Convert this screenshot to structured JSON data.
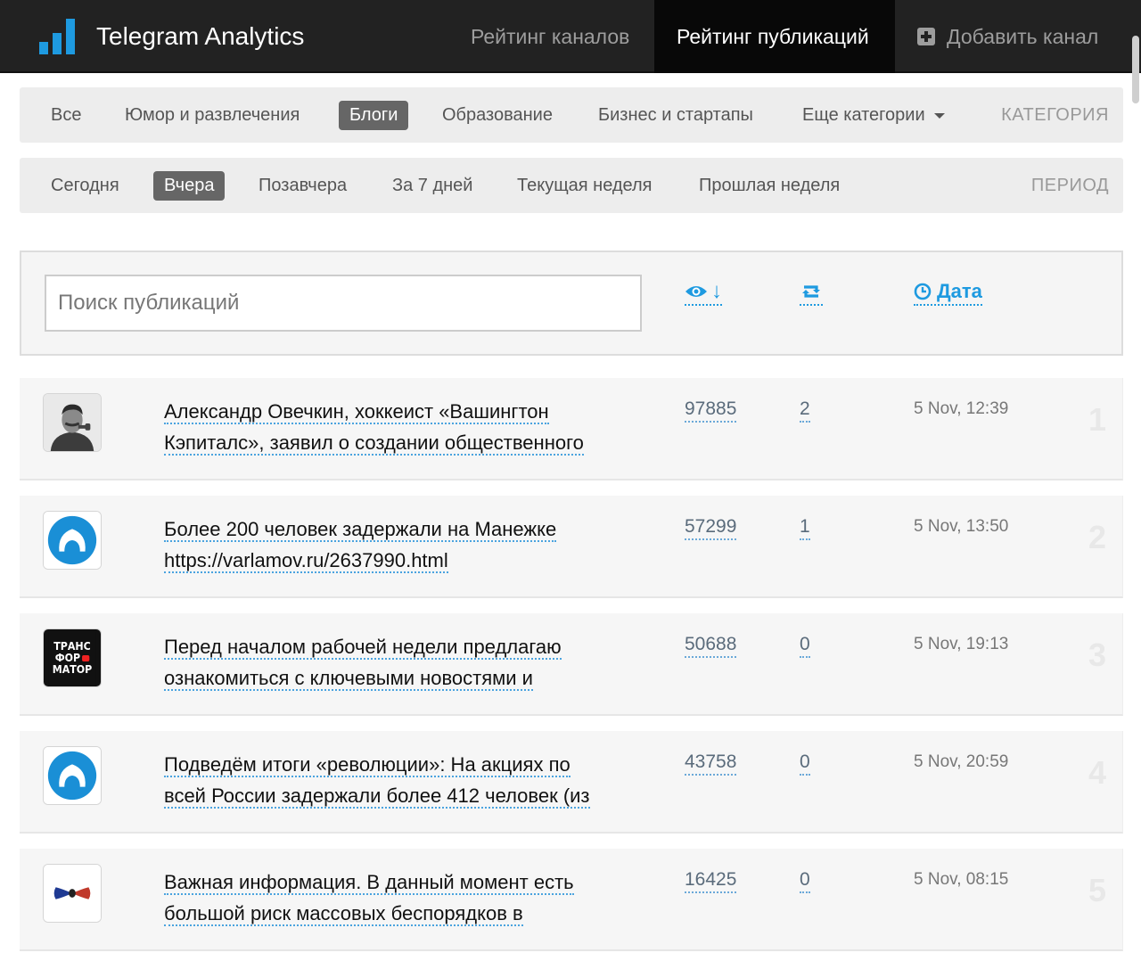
{
  "nav": {
    "brand_title": "Telegram Analytics",
    "items": [
      {
        "label": "Рейтинг каналов"
      },
      {
        "label": "Рейтинг публикаций"
      },
      {
        "label": "Добавить канал"
      }
    ]
  },
  "categories": {
    "items": [
      "Все",
      "Юмор и развлечения",
      "Блоги",
      "Образование",
      "Бизнес и стартапы",
      "Еще категории"
    ],
    "active": "Блоги",
    "label": "КАТЕГОРИЯ"
  },
  "periods": {
    "items": [
      "Сегодня",
      "Вчера",
      "Позавчера",
      "За 7 дней",
      "Текущая неделя",
      "Прошлая неделя"
    ],
    "active": "Вчера",
    "label": "ПЕРИОД"
  },
  "search": {
    "placeholder": "Поиск публикаций",
    "value": "",
    "views_arrow": "↓",
    "date_label": "Дата"
  },
  "colors": {
    "accent": "#1e9ae0",
    "navbar": "#222222"
  },
  "posts": [
    {
      "title_line1": "Александр Овечкин, хоккеист «Вашингтон",
      "title_line2": "Кэпиталс», заявил о создании общественного",
      "views": "97885",
      "shares": "2",
      "date": "5 Nov, 12:39",
      "rank": "1",
      "avatar": "portrait-avatar"
    },
    {
      "title_line1": "Более 200 человек задержали на Манежке",
      "title_line2": "https://varlamov.ru/2637990.html",
      "views": "57299",
      "shares": "1",
      "date": "5 Nov, 13:50",
      "rank": "2",
      "avatar": "blue-circle-avatar"
    },
    {
      "title_line1": "Перед началом рабочей недели предлагаю",
      "title_line2": "ознакомиться с ключевыми новостями и",
      "views": "50688",
      "shares": "0",
      "date": "5 Nov, 19:13",
      "rank": "3",
      "avatar": "transformator-logo",
      "avatar_text": [
        "ТРАНС",
        "ФОР",
        "МАТОР"
      ]
    },
    {
      "title_line1": "Подведём итоги «революции»: На акциях по",
      "title_line2": "всей России задержали более 412 человек (из",
      "views": "43758",
      "shares": "0",
      "date": "5 Nov, 20:59",
      "rank": "4",
      "avatar": "blue-circle-avatar"
    },
    {
      "title_line1": "Важная информация. В данный момент есть",
      "title_line2": "большой риск массовых беспорядков в",
      "views": "16425",
      "shares": "0",
      "date": "5 Nov, 08:15",
      "rank": "5",
      "avatar": "bowtie-logo"
    }
  ]
}
